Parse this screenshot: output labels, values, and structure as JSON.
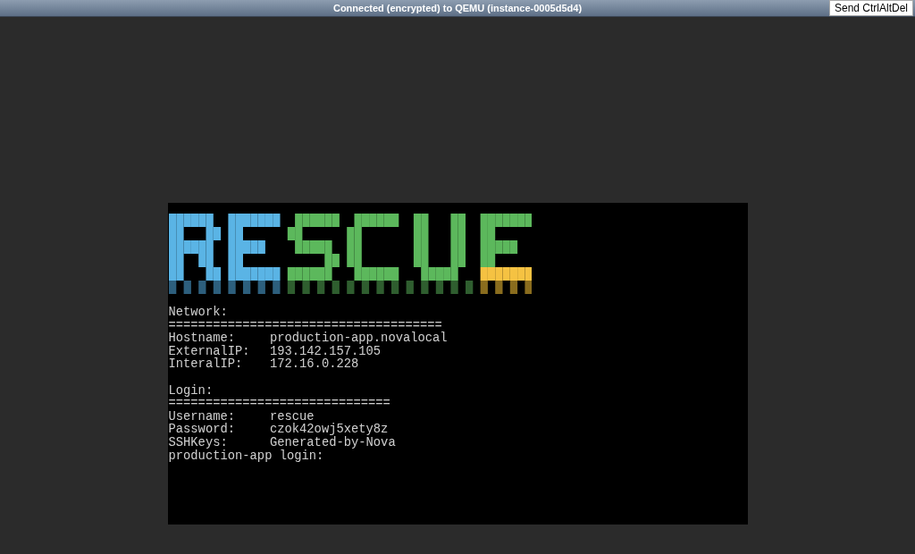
{
  "top_bar": {
    "status": "Connected (encrypted) to QEMU (instance-0005d5d4)",
    "button": "Send CtrlAltDel"
  },
  "console": {
    "sections": [
      {
        "heading": "Network:",
        "rule": "=====================================",
        "rows": [
          {
            "label": "Hostname:",
            "value": "production-app.novalocal"
          },
          {
            "label": "ExternalIP:",
            "value": "193.142.157.105"
          },
          {
            "label": "InteralIP:",
            "value": "172.16.0.228"
          }
        ]
      },
      {
        "heading": "Login:",
        "rule": "==============================",
        "rows": [
          {
            "label": "Username:",
            "value": "rescue"
          },
          {
            "label": "Password:",
            "value": "czok42owj5xety8z"
          },
          {
            "label": "SSHKeys:",
            "value": "Generated-by-Nova"
          }
        ]
      }
    ],
    "prompt": "production-app login:"
  }
}
